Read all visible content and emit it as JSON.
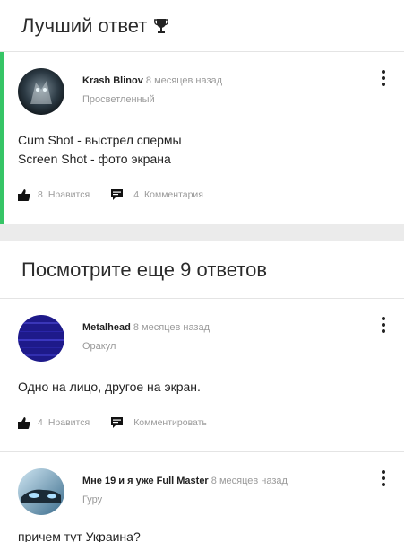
{
  "best_section": {
    "title": "Лучший ответ"
  },
  "more_section": {
    "title": "Посмотрите еще 9 ответов"
  },
  "answers": [
    {
      "author": "Krash Blinov",
      "time": "8 месяцев назад",
      "rank": "Просветленный",
      "lines": [
        "Cum Shot - выстрел спермы",
        "Screen Shot - фото экрана"
      ],
      "likes_count": "8",
      "likes_label": "Нравится",
      "comments_count": "4",
      "comments_label": "Комментария"
    },
    {
      "author": "Metalhead",
      "time": "8 месяцев назад",
      "rank": "Оракул",
      "lines": [
        "Одно на лицо, другое на экран."
      ],
      "likes_count": "4",
      "likes_label": "Нравится",
      "comments_count": "",
      "comments_label": "Комментировать"
    },
    {
      "author": "Мне 19 и я уже Full Master",
      "time": "8 месяцев назад",
      "rank": "Гуру",
      "lines": [
        "причем тут Украина?"
      ]
    }
  ],
  "colors": {
    "accent_green": "#36c566"
  },
  "icons": [
    "trophy-icon",
    "thumbs-up-icon",
    "comment-icon",
    "more-vert-icon"
  ]
}
